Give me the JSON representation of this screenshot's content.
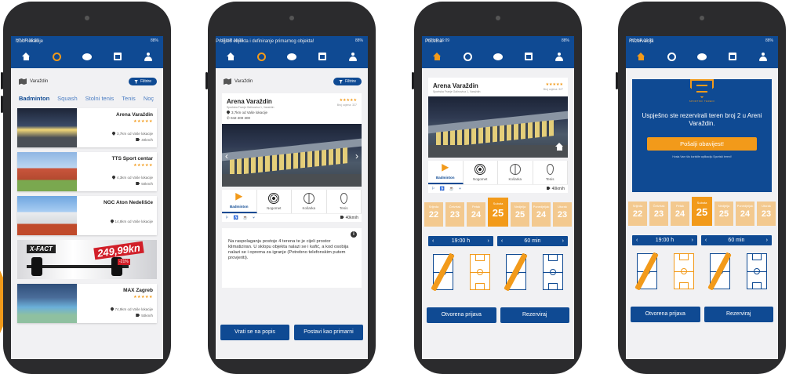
{
  "colors": {
    "primary": "#0f4a93",
    "accent": "#f29a1a",
    "accent_light": "#f3c98f",
    "screen_bg": "#f1f1f3"
  },
  "status": {
    "carrier_time": "HT HR  16:09",
    "battery": "88%"
  },
  "nav_icons": [
    "home-icon",
    "volleyball-icon",
    "chat-icon",
    "calendar-icon",
    "user-icon"
  ],
  "screen1": {
    "caption": "Izbor lokacije",
    "location": "Varaždin",
    "filter_label": "Filtrire",
    "tabs": [
      "Badminton",
      "Squash",
      "Stolni tenis",
      "Tenis",
      "Noç"
    ],
    "venues": [
      {
        "name": "Arena Varaždin",
        "stars": "★★★★★",
        "distance": "3,7km od Vaše lokacije",
        "speed": "40km/h"
      },
      {
        "name": "TTS Sport centar",
        "stars": "★★★★★",
        "distance": "4,3km od Vaše lokacije",
        "speed": "50km/h"
      },
      {
        "name": "NGC Aton Nedelišće",
        "stars": "",
        "distance": "14,8km od Vaše lokacije",
        "speed": ""
      },
      {
        "name": "MAX Zagreb",
        "stars": "★★★★★",
        "distance": "74,9km od Vaše lokacije",
        "speed": "50km/h"
      }
    ],
    "ad": {
      "brand": "X-FACT",
      "price": "249,99kn",
      "discount": "-21%"
    }
  },
  "screen2": {
    "caption": "Pregled objekta i definiranje primarnog objekta!",
    "location": "Varaždin",
    "filter_label": "Filtrire",
    "venue_name": "Arena Varaždin",
    "venue_sub": "Sportska Franje Galinovica 1, Varaždin",
    "stars": "★★★★★",
    "reviews": "Broj ocjena: 327",
    "distance": "3,7km od Vaše lokacije",
    "phone": "042 200 300",
    "sports": [
      "Badminton",
      "Nogomet",
      "Košarka",
      "Tenis"
    ],
    "speed": "40km/h",
    "description": "Na raspolaganju postoje 4 terena te je cijeli prostor klimatiziran. U sklopu objekta nalazi se i kafić, a kod osobija nalazi se i oprema za igranje (Potrebno telefonskim putem provjeriti).",
    "btn_back": "Vrati se na popis",
    "btn_primary": "Postavi kao primarni"
  },
  "screen3": {
    "caption": "Početna",
    "venue_name": "Arena Varaždin",
    "venue_sub": "Sportska Franje Galinovica 1, Varaždin",
    "stars": "★★★★★",
    "reviews": "Broj ocjena: 327",
    "sports": [
      "Badminton",
      "Nogomet",
      "Košarka",
      "Tenis"
    ],
    "speed": "40km/h",
    "dates": [
      {
        "day": "Srijeda",
        "num": "22"
      },
      {
        "day": "Četvrtak",
        "num": "23"
      },
      {
        "day": "Petak",
        "num": "24"
      },
      {
        "day": "Subota",
        "num": "25"
      },
      {
        "day": "Nedjelja",
        "num": "25"
      },
      {
        "day": "Ponedjeljak",
        "num": "24"
      },
      {
        "day": "Utorak",
        "num": "23"
      }
    ],
    "time": "19:00 h",
    "duration": "60 min",
    "btn_open": "Otvorena prijava",
    "btn_book": "Rezerviraj"
  },
  "screen4": {
    "caption": "Rezervacija",
    "logo_text": "SPORTSKI TERENI",
    "message": "Uspješno ste rezervirali teren broj 2 u Areni Varaždin.",
    "notify_btn": "Pošalji obavijest!",
    "thanks": "Hvala Vam što koristite aplikaciju Sportski tereni!",
    "dates": [
      {
        "day": "Srijeda",
        "num": "22"
      },
      {
        "day": "Četvrtak",
        "num": "23"
      },
      {
        "day": "Petak",
        "num": "24"
      },
      {
        "day": "Subota",
        "num": "25"
      },
      {
        "day": "Nedjelja",
        "num": "25"
      },
      {
        "day": "Ponedjeljak",
        "num": "24"
      },
      {
        "day": "Utorak",
        "num": "23"
      }
    ],
    "time": "19:00 h",
    "duration": "60 min",
    "btn_open": "Otvorena prijava",
    "btn_book": "Rezerviraj"
  }
}
